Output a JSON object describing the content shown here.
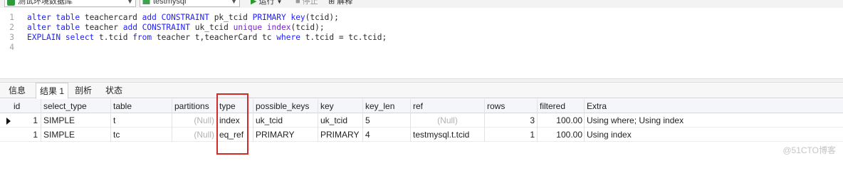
{
  "toolbar": {
    "connection": "测试环境数据库",
    "database": "testmysql",
    "run_label": "运行",
    "stop_label": "停止",
    "explain_label": "解释"
  },
  "editor": {
    "lines": [
      {
        "num": "1",
        "parts": [
          [
            "kw",
            "alter table"
          ],
          [
            "tx",
            " teachercard "
          ],
          [
            "kw",
            "add CONSTRAINT"
          ],
          [
            "tx",
            " pk_tcid "
          ],
          [
            "kw",
            "PRIMARY key"
          ],
          [
            "tx",
            "(tcid);"
          ]
        ]
      },
      {
        "num": "2",
        "parts": [
          [
            "kw",
            "alter table"
          ],
          [
            "tx",
            " teacher "
          ],
          [
            "kw",
            "add CONSTRAINT"
          ],
          [
            "tx",
            " uk_tcid "
          ],
          [
            "fn",
            "unique index"
          ],
          [
            "tx",
            "(tcid);"
          ]
        ]
      },
      {
        "num": "3",
        "parts": [
          [
            "kw",
            "EXPLAIN select"
          ],
          [
            "tx",
            " t.tcid "
          ],
          [
            "kw",
            "from"
          ],
          [
            "tx",
            " teacher t,teacherCard tc "
          ],
          [
            "kw",
            "where"
          ],
          [
            "tx",
            " t.tcid = tc.tcid;"
          ]
        ]
      },
      {
        "num": "4",
        "parts": []
      }
    ]
  },
  "tabs": [
    "信息",
    "结果 1",
    "剖析",
    "状态"
  ],
  "results": {
    "columns": [
      "id",
      "select_type",
      "table",
      "partitions",
      "type",
      "possible_keys",
      "key",
      "key_len",
      "ref",
      "rows",
      "filtered",
      "Extra"
    ],
    "rows": [
      [
        "1",
        "SIMPLE",
        "t",
        "(Null)",
        "index",
        "uk_tcid",
        "uk_tcid",
        "5",
        "(Null)",
        "3",
        "100.00",
        "Using where; Using index"
      ],
      [
        "1",
        "SIMPLE",
        "tc",
        "(Null)",
        "eq_ref",
        "PRIMARY",
        "PRIMARY",
        "4",
        "testmysql.t.tcid",
        "1",
        "100.00",
        "Using index"
      ]
    ]
  },
  "watermark": "@51CTO博客",
  "colors": {
    "keyword": "#1e1eff",
    "function": "#7a1fd6",
    "highlight": "#d12a2a"
  }
}
